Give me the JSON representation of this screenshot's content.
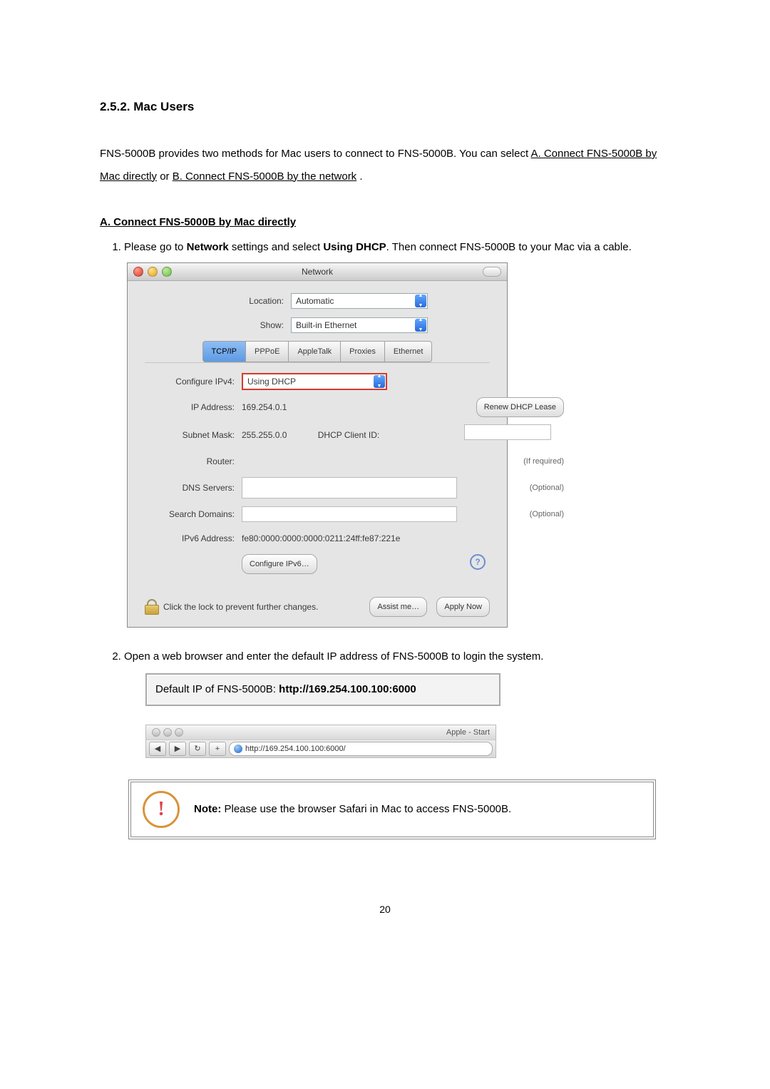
{
  "heading": "2.5.2.  Mac Users",
  "intro": {
    "p1a": "FNS-5000B provides two methods for Mac users to connect to FNS-5000B.  You can select ",
    "linkA": "A. Connect FNS-5000B by Mac directly",
    "mid": " or ",
    "linkB": "B. Connect FNS-5000B by the network",
    "end": "."
  },
  "secA": "A. Connect FNS-5000B by Mac directly",
  "step1": {
    "pre": "Please go to ",
    "b1": "Network",
    "mid": " settings and select ",
    "b2": "Using DHCP",
    "post": ".  Then connect FNS-5000B to your Mac via a cable."
  },
  "macwin": {
    "title": "Network",
    "location_label": "Location:",
    "location_value": "Automatic",
    "show_label": "Show:",
    "show_value": "Built-in Ethernet",
    "tabs": [
      "TCP/IP",
      "PPPoE",
      "AppleTalk",
      "Proxies",
      "Ethernet"
    ],
    "configure_label": "Configure IPv4:",
    "configure_value": "Using DHCP",
    "ip_label": "IP Address:",
    "ip_value": "169.254.0.1",
    "renew_btn": "Renew DHCP Lease",
    "subnet_label": "Subnet Mask:",
    "subnet_value": "255.255.0.0",
    "dhcpid_label": "DHCP Client ID:",
    "dhcpid_hint": "(If required)",
    "router_label": "Router:",
    "dns_label": "DNS Servers:",
    "dns_hint": "(Optional)",
    "search_label": "Search Domains:",
    "search_hint": "(Optional)",
    "ipv6_label": "IPv6 Address:",
    "ipv6_value": "fe80:0000:0000:0000:0211:24ff:fe87:221e",
    "configure_ipv6_btn": "Configure IPv6…",
    "lock_text": "Click the lock to prevent further changes.",
    "assist_btn": "Assist me…",
    "apply_btn": "Apply Now"
  },
  "step2": "Open a web browser and enter the default IP address of FNS-5000B to login the system.",
  "defip": {
    "pre": "Default IP of FNS-5000B: ",
    "url": "http://169.254.100.100:6000"
  },
  "safari": {
    "title": "Apple - Start",
    "url": "http://169.254.100.100:6000/"
  },
  "note": {
    "label": "Note:",
    "text": " Please use the browser Safari in Mac to access FNS-5000B."
  },
  "page_number": "20"
}
